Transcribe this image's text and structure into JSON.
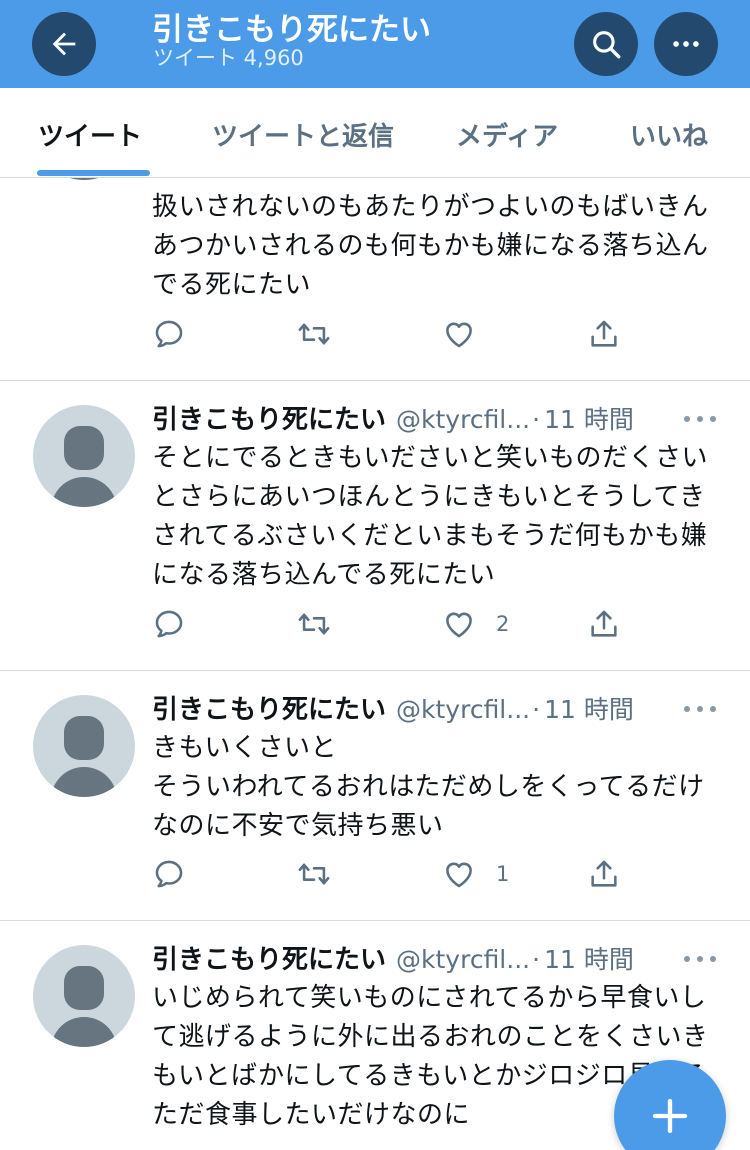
{
  "header": {
    "title": "引きこもり死にたい",
    "subtitle": "ツイート 4,960"
  },
  "tabs": [
    {
      "label": "ツイート",
      "active": true
    },
    {
      "label": "ツイートと返信",
      "active": false
    },
    {
      "label": "メディア",
      "active": false
    },
    {
      "label": "いいね",
      "active": false
    }
  ],
  "tweets": [
    {
      "partial": true,
      "text": "扱いされないのもあたりがつよいのもばいきんあつかいされるのも何もかも嫌になる落ち込んでる死にたい",
      "likes": ""
    },
    {
      "name": "引きこもり死にたい",
      "handle": "@ktyrcfil...",
      "dot": "·",
      "time": "11 時間",
      "text": "そとにでるときもいださいと笑いものだくさいとさらにあいつほんとうにきもいとそうしてきされてるぶさいくだといまもそうだ何もかも嫌になる落ち込んでる死にたい",
      "likes": "2"
    },
    {
      "name": "引きこもり死にたい",
      "handle": "@ktyrcfil...",
      "dot": "·",
      "time": "11 時間",
      "text": "きもいくさいと\nそういわれてるおれはただめしをくってるだけなのに不安で気持ち悪い",
      "likes": "1"
    },
    {
      "name": "引きこもり死にたい",
      "handle": "@ktyrcfil...",
      "dot": "·",
      "time": "11 時間",
      "text": "いじめられて笑いものにされてるから早食いして逃げるように外に出るおれのことをくさいきもいとばかにしてるきもいとかジロジロ見てるただ食事したいだけなのに",
      "likes": ""
    }
  ],
  "icons": {
    "back": "arrow-left-icon",
    "search": "search-icon",
    "more": "more-horizontal-icon",
    "reply": "reply-icon",
    "retweet": "retweet-icon",
    "like": "heart-icon",
    "share": "share-icon",
    "compose": "plus-icon"
  },
  "colors": {
    "header_bg": "#4c9be8",
    "button_dark": "#23496f",
    "accent": "#4c9be8",
    "muted": "#5b7083"
  }
}
